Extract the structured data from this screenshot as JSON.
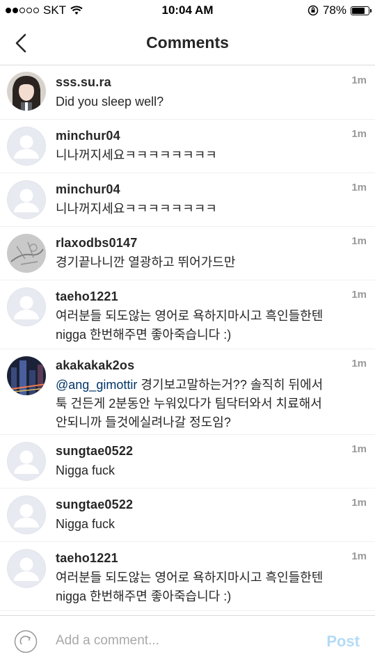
{
  "status": {
    "carrier": "SKT",
    "time": "10:04 AM",
    "battery": "78%",
    "battery_level": 0.78
  },
  "nav": {
    "title": "Comments"
  },
  "comments": [
    {
      "username": "sss.su.ra",
      "text": "Did you sleep well?",
      "time": "1m",
      "avatar": "photo-girl"
    },
    {
      "username": "minchur04",
      "text": "니나꺼지세요ㅋㅋㅋㅋㅋㅋㅋㅋ",
      "time": "1m",
      "avatar": "default"
    },
    {
      "username": "minchur04",
      "text": "니나꺼지세요ㅋㅋㅋㅋㅋㅋㅋㅋ",
      "time": "1m",
      "avatar": "default"
    },
    {
      "username": "rlaxodbs0147",
      "text": "경기끝나니깐 열광하고 뛰어가드만",
      "time": "1m",
      "avatar": "photo-sketch"
    },
    {
      "username": "taeho1221",
      "text": "여러분들 되도않는 영어로 욕하지마시고 흑인들한텐 nigga 한번해주면 좋아죽습니다 :)",
      "time": "1m",
      "avatar": "default"
    },
    {
      "username": "akakakak2os",
      "mention": "@ang_gimottir",
      "text": " 경기보고말하는거?? 솔직히 뒤에서 툭 건든게 2분동안 누워있다가 팀닥터와서 치료해서 안되니까 들것에실려나갈 정도임?",
      "time": "1m",
      "avatar": "photo-city"
    },
    {
      "username": "sungtae0522",
      "text": "Nigga fuck",
      "time": "1m",
      "avatar": "default"
    },
    {
      "username": "sungtae0522",
      "text": "Nigga fuck",
      "time": "1m",
      "avatar": "default"
    },
    {
      "username": "taeho1221",
      "text": "여러분들 되도않는 영어로 욕하지마시고 흑인들한텐 nigga 한번해주면 좋아죽습니다 :)",
      "time": "1m",
      "avatar": "default"
    }
  ],
  "composer": {
    "placeholder": "Add a comment...",
    "post_label": "Post"
  }
}
